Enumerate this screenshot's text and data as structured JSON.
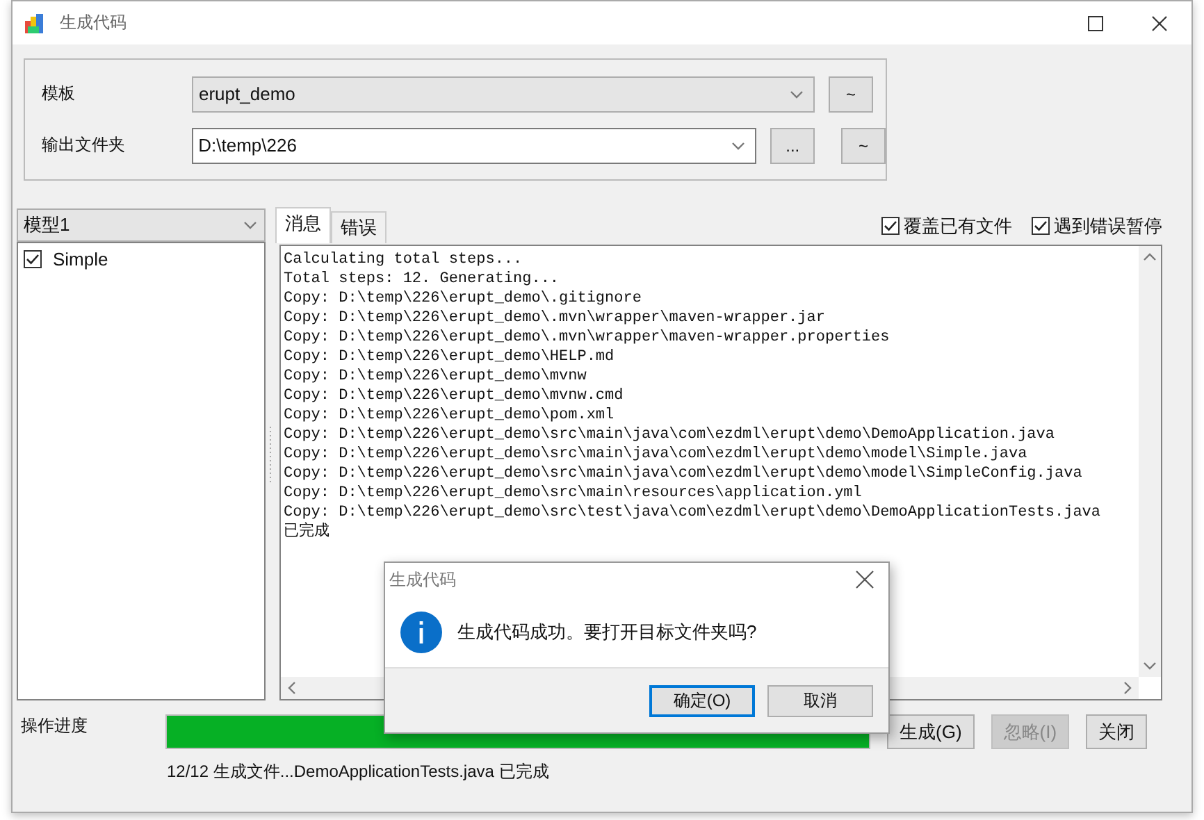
{
  "window": {
    "title": "生成代码"
  },
  "settings": {
    "template": {
      "label": "模板",
      "value": "erupt_demo"
    },
    "output_folder": {
      "label": "输出文件夹",
      "value": "D:\\temp\\226"
    },
    "template_button": "~",
    "browse_button": "...",
    "folder_button": "~"
  },
  "model_select": {
    "value": "模型1"
  },
  "models": [
    {
      "label": "Simple",
      "checked": true
    }
  ],
  "tabs": [
    {
      "label": "消息",
      "selected": true
    },
    {
      "label": "错误",
      "selected": false
    }
  ],
  "options": [
    {
      "label": "覆盖已有文件",
      "checked": true
    },
    {
      "label": "遇到错误暂停",
      "checked": true
    }
  ],
  "log": [
    "Calculating total steps...",
    "Total steps: 12. Generating...",
    "Copy: D:\\temp\\226\\erupt_demo\\.gitignore",
    "Copy: D:\\temp\\226\\erupt_demo\\.mvn\\wrapper\\maven-wrapper.jar",
    "Copy: D:\\temp\\226\\erupt_demo\\.mvn\\wrapper\\maven-wrapper.properties",
    "Copy: D:\\temp\\226\\erupt_demo\\HELP.md",
    "Copy: D:\\temp\\226\\erupt_demo\\mvnw",
    "Copy: D:\\temp\\226\\erupt_demo\\mvnw.cmd",
    "Copy: D:\\temp\\226\\erupt_demo\\pom.xml",
    "Copy: D:\\temp\\226\\erupt_demo\\src\\main\\java\\com\\ezdml\\erupt\\demo\\DemoApplication.java",
    "Copy: D:\\temp\\226\\erupt_demo\\src\\main\\java\\com\\ezdml\\erupt\\demo\\model\\Simple.java",
    "Copy: D:\\temp\\226\\erupt_demo\\src\\main\\java\\com\\ezdml\\erupt\\demo\\model\\SimpleConfig.java",
    "Copy: D:\\temp\\226\\erupt_demo\\src\\main\\resources\\application.yml",
    "Copy: D:\\temp\\226\\erupt_demo\\src\\test\\java\\com\\ezdml\\erupt\\demo\\DemoApplicationTests.java",
    "已完成"
  ],
  "progress": {
    "label": "操作进度",
    "level": 1,
    "status": "12/12 生成文件...DemoApplicationTests.java 已完成"
  },
  "actions": [
    {
      "label": "生成(G)",
      "disabled": false
    },
    {
      "label": "忽略(I)",
      "disabled": true
    },
    {
      "label": "关闭",
      "disabled": false
    }
  ],
  "dialog": {
    "title": "生成代码",
    "message": "生成代码成功。要打开目标文件夹吗?",
    "buttons": [
      {
        "label": "确定(O)",
        "default": true
      },
      {
        "label": "取消",
        "default": false
      }
    ]
  }
}
